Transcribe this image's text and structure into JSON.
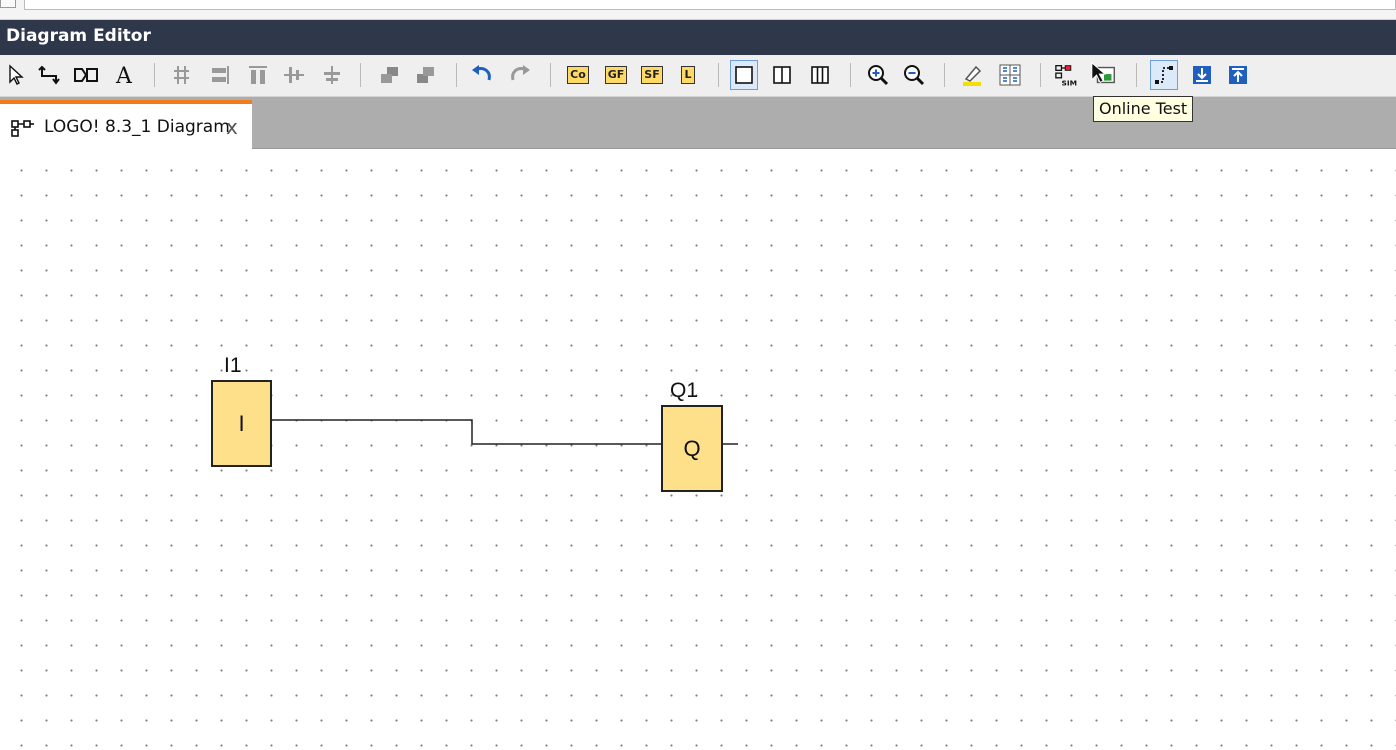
{
  "window": {
    "title": "Diagram Editor"
  },
  "toolbar": {
    "tags": {
      "co": "Co",
      "gf": "GF",
      "sf": "SF",
      "l": "L"
    },
    "sim_label": "SIM",
    "tooltip": "Online Test"
  },
  "tabs": [
    {
      "label": "LOGO! 8.3_1 Diagram",
      "close": "x"
    }
  ],
  "diagram": {
    "input_block": {
      "name": "I1",
      "symbol": "I"
    },
    "output_block": {
      "name": "Q1",
      "symbol": "Q"
    }
  },
  "colors": {
    "title_bar": "#2f374a",
    "tab_accent": "#f27c1c",
    "block_fill": "#ffe08a",
    "tool_blue": "#1f5fbf"
  }
}
